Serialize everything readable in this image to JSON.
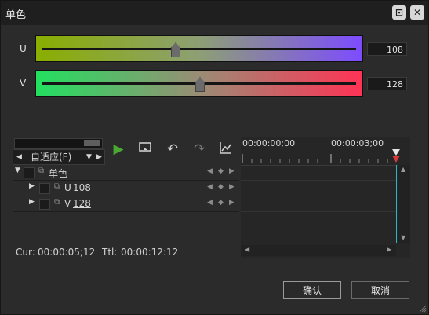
{
  "window": {
    "title": "单色",
    "buttons": {
      "maximize_icon": "circle-square-icon",
      "close_icon": "close-icon"
    }
  },
  "channels": [
    {
      "label": "U",
      "value": "108",
      "level": 0.42
    },
    {
      "label": "V",
      "value": "128",
      "level": 0.5
    }
  ],
  "timeline_controls": {
    "zoom_select": "自适应(F)",
    "zoom_level": 0.85
  },
  "ruler": {
    "time_start": "00:00:00;00",
    "time_mid": "00:00:03;00"
  },
  "tree": [
    {
      "name": "单色",
      "value": ""
    },
    {
      "name": "U",
      "value": "108"
    },
    {
      "name": "V",
      "value": "128"
    }
  ],
  "status": {
    "cur_label": "Cur:",
    "cur_value": "00:00:05;12",
    "ttl_label": "Ttl:",
    "ttl_value": "00:00:12:12"
  },
  "buttons": {
    "ok": "确认",
    "cancel": "取消"
  },
  "colors": {
    "play": "#4aa832",
    "cursor": "#2fb5c0"
  }
}
